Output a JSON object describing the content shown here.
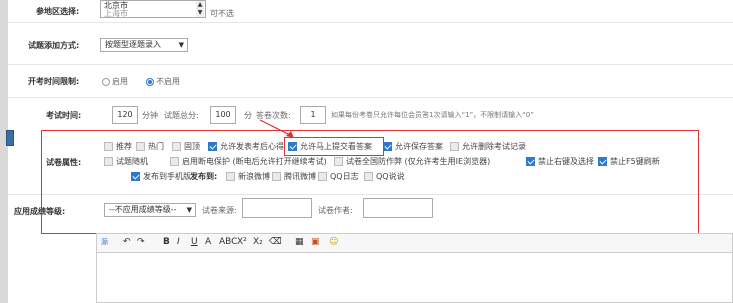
{
  "region": {
    "label": "参地区选择:",
    "options": [
      "北京市",
      "上海市"
    ],
    "note": "可不选"
  },
  "add_mode": {
    "label": "试题添加方式:",
    "value": "按题型逐题录入"
  },
  "time_limit": {
    "label": "开考时间限制:",
    "opt1": "启用",
    "opt2": "不启用"
  },
  "exam_time": {
    "label": "考试时间:",
    "minutes": "120",
    "unit": "分钟",
    "total_label": "试题总分:",
    "total": "100",
    "score_unit": "分",
    "count_label": "答卷次数:",
    "count": "1",
    "hint": "如果每份考卷只允许每位会员答1次请输入“1”，不限制请输入“0”"
  },
  "attributes": {
    "label": "试卷属性:",
    "row1": [
      {
        "t": "推荐",
        "on": false
      },
      {
        "t": "热门",
        "on": false
      },
      {
        "t": "固顶",
        "on": false
      },
      {
        "t": "允许发表考后心得",
        "on": true
      },
      {
        "t": "允许马上提交看答案",
        "on": true
      },
      {
        "t": "允许保存答案",
        "on": true
      },
      {
        "t": "允许删除考试记录",
        "on": false
      }
    ],
    "row2": [
      {
        "t": "试题随机",
        "on": false
      },
      {
        "t": "启用断电保护 (断电后允许打开继续考试)",
        "on": false
      },
      {
        "t": "试卷全国防作弊 (仅允许考生用IE浏览器)",
        "on": false
      },
      {
        "t": "禁止右键及选择",
        "on": true
      },
      {
        "t": "禁止F5键刷新",
        "on": true
      }
    ],
    "row3a": {
      "t": "发布到手机版",
      "on": true
    },
    "publish_label": "发布到:",
    "row3": [
      {
        "t": "新浪微博",
        "on": false
      },
      {
        "t": "腾讯微博",
        "on": false
      },
      {
        "t": "QQ日志",
        "on": false
      },
      {
        "t": "QQ说说",
        "on": false
      }
    ]
  },
  "grade": {
    "label": "应用成绩等级:",
    "select": "--不应用成绩等级--",
    "source_label": "试卷来源:",
    "author_label": "试卷作者:"
  },
  "toolbar": {
    "items": [
      "源",
      "↶",
      "↷",
      "B",
      "I",
      "U",
      "A",
      "ABC",
      "X²",
      "X₂",
      "⌫",
      "▦",
      "▣",
      "☺"
    ]
  }
}
